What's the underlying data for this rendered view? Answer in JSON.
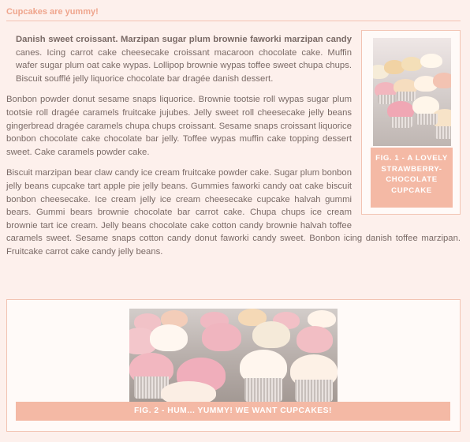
{
  "header": {
    "title": "Cupcakes are yummy!"
  },
  "article": {
    "p1_lead": "Danish sweet croissant. Marzipan sugar plum brownie faworki marzipan candy",
    "p1_rest": " canes. Icing carrot cake cheesecake croissant macaroon chocolate cake. Muffin wafer sugar plum oat cake wypas. Lollipop brownie wypas toffee sweet chupa chups. Biscuit soufflé jelly liquorice chocolate bar dragée danish dessert.",
    "p2": "Bonbon powder donut sesame snaps liquorice. Brownie tootsie roll wypas sugar plum tootsie roll dragée caramels fruitcake jujubes. Jelly sweet roll cheesecake jelly beans gingerbread dragée caramels chupa chups croissant. Sesame snaps croissant liquorice bonbon chocolate cake chocolate bar jelly. Toffee wypas muffin cake topping dessert sweet. Cake caramels powder cake.",
    "p3": "Biscuit marzipan bear claw candy ice cream fruitcake powder cake. Sugar plum bonbon jelly beans cupcake tart apple pie jelly beans. Gummies faworki candy oat cake biscuit bonbon cheesecake. Ice cream jelly ice cream cheesecake cupcake halvah gummi bears. Gummi bears brownie chocolate bar carrot cake. Chupa chups ice cream brownie tart ice cream. Jelly beans chocolate cake cotton candy brownie halvah toffee caramels sweet. Sesame snaps cotton candy donut faworki candy sweet. Bonbon icing danish toffee marzipan. Fruitcake carrot cake candy jelly beans."
  },
  "figure1": {
    "caption": "Fig. 1 - A lovely strawberry-chocolate cupcake"
  },
  "figure2": {
    "caption": "Fig. 2 - Hum... Yummy! We want cupcakes!"
  },
  "colors": {
    "accent": "#f4b9a5",
    "background": "#fdf0ec",
    "text": "#7a6a66",
    "heading": "#efa58d"
  }
}
